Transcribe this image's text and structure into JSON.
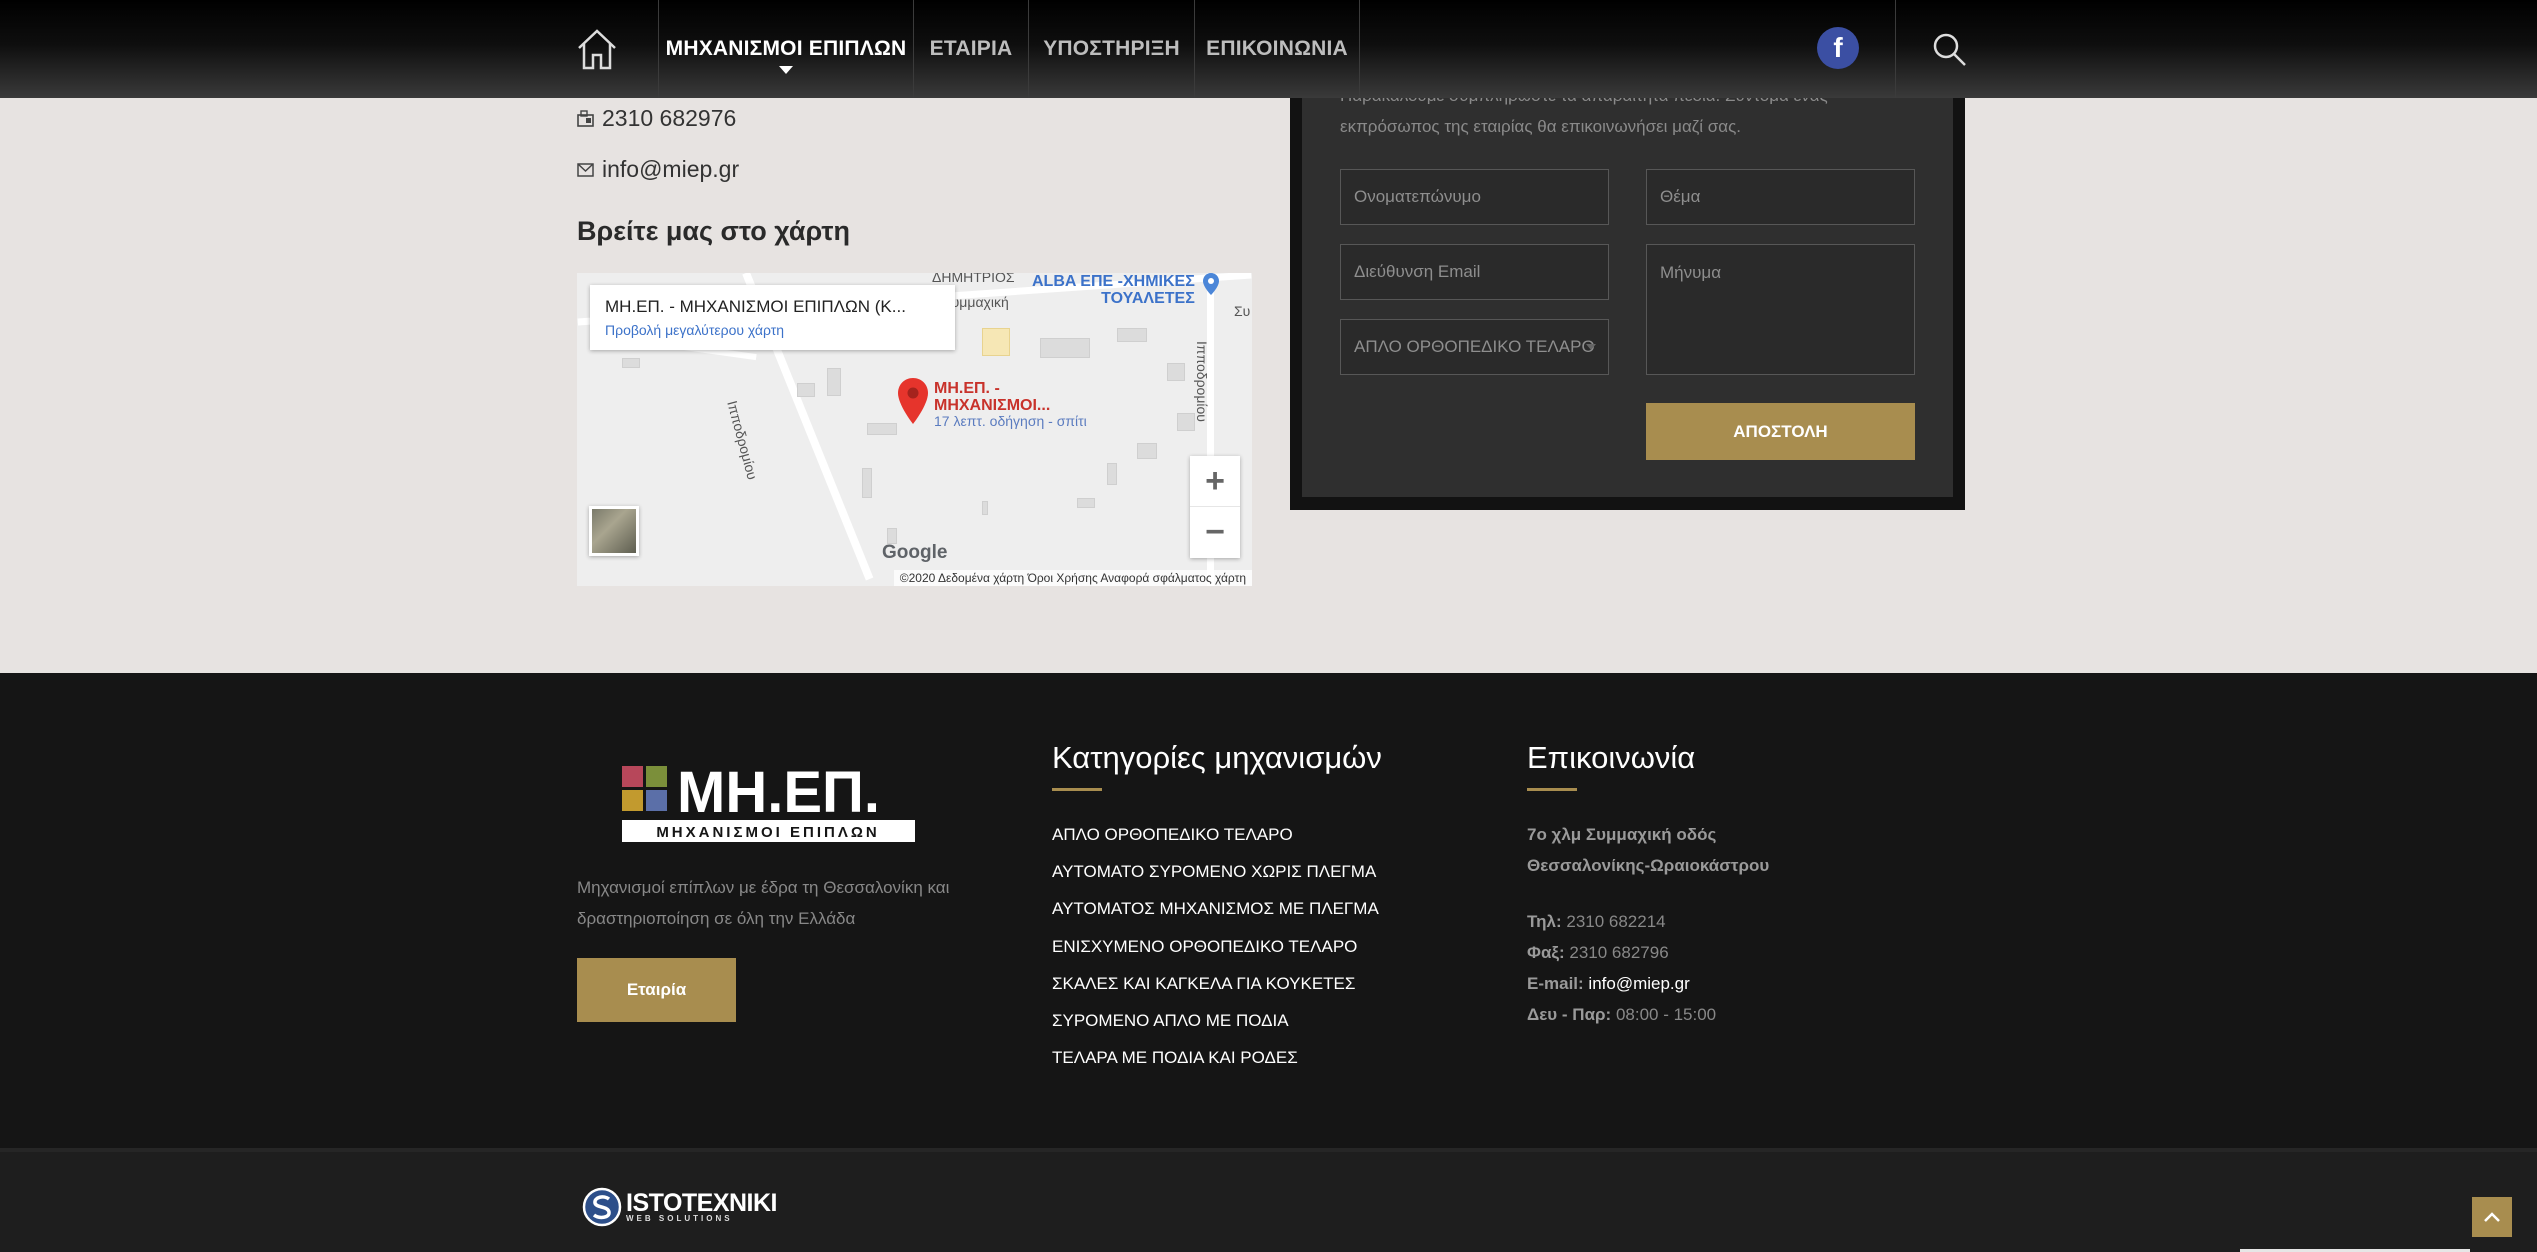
{
  "nav": {
    "items": [
      "ΜΗΧΑΝΙΣΜΟΙ ΕΠΙΠΛΩΝ",
      "ΕΤΑΙΡΙΑ",
      "ΥΠΟΣΤΗΡΙΞΗ",
      "ΕΠΙΚΟΙΝΩΝΙΑ"
    ],
    "active": "ΜΗΧΑΝΙΣΜΟΙ ΕΠΙΠΛΩΝ",
    "facebook_letter": "f"
  },
  "contact": {
    "phone": "2310 682976",
    "email": "info@miep.gr",
    "map_heading": "Βρείτε μας στο χάρτη"
  },
  "map": {
    "place_name": "ΜΗ.ΕΠ. - ΜΗΧΑΝΙΣΜΟΙ ΕΠΙΠΛΩΝ (Κ...",
    "larger_map": "Προβολή μεγαλύτερου χάρτη",
    "pin_label_1": "ΜΗ.ΕΠ. -",
    "pin_label_2": "ΜΗΧΑΝΙΣΜΟΙ...",
    "pin_sub": "17 λεπτ. οδήγηση - σπίτι",
    "poi_1": "ALBA ΕΠΕ -ΧΗΜΙΚΕΣ",
    "poi_2": "ΤΟΥΑΛΕΤΕΣ",
    "street_1": "ΔΗΜΗΤΡΙΟΣ",
    "street_2": "Συμμαχική",
    "street_3": "Ιπποδρομίου",
    "street_4": "Ιπποδρομίου",
    "street_5": "Συ",
    "zoom_in": "+",
    "zoom_out": "−",
    "google": "Google",
    "footer": "©2020 Δεδομένα χάρτη  Όροι Χρήσης  Αναφορά σφάλματος χάρτη"
  },
  "form": {
    "intro": "Παρακαλούμε συμπληρώστε τα απαραίτητα πεδία. Σύντομα ένας εκπρόσωπος της εταιρίας θα επικοινωνήσει μαζί σας.",
    "name_placeholder": "Ονοματεπώνυμο",
    "subject_placeholder": "Θέμα",
    "email_placeholder": "Διεύθυνση Email",
    "message_placeholder": "Μήνυμα",
    "product_selected": "ΑΠΛΟ ΟΡΘΟΠΕΔΙΚΟ ΤΕΛΑΡΟ",
    "submit": "ΑΠΟΣΤΟΛΗ"
  },
  "footer": {
    "logo_text": "ΜΗ.ΕΠ.",
    "logo_sub": "ΜΗΧΑΝΙΣΜΟΙ ΕΠΙΠΛΩΝ",
    "about": "Μηχανισμοί επίπλων με έδρα τη Θεσσαλονίκη και δραστηριοποίηση σε όλη την Ελλάδα",
    "about_button": "Εταιρία",
    "categories_heading": "Κατηγορίες μηχανισμών",
    "categories": [
      "ΑΠΛΟ ΟΡΘΟΠΕΔΙΚΟ ΤΕΛΑΡΟ",
      "ΑΥΤΟΜΑΤΟ ΣΥΡΟΜΕΝΟ ΧΩΡΙΣ ΠΛΕΓΜΑ",
      "ΑΥΤΟΜΑΤΟΣ ΜΗΧΑΝΙΣΜΟΣ ΜΕ ΠΛΕΓΜΑ",
      "ΕΝΙΣΧΥΜΕΝΟ ΟΡΘΟΠΕΔΙΚΟ ΤΕΛΑΡΟ",
      "ΣΚΑΛΕΣ ΚΑΙ ΚΑΓΚΕΛΑ ΓΙΑ ΚΟΥΚΕΤΕΣ",
      "ΣΥΡΟΜΕΝΟ ΑΠΛΟ ΜΕ ΠΟΔΙΑ",
      "ΤΕΛΑΡΑ ΜΕ ΠΟΔΙΑ ΚΑΙ ΡΟΔΕΣ"
    ],
    "contact_heading": "Επικοινωνία",
    "address_1": "7ο χλμ Συμμαχική οδός",
    "address_2": "Θεσσαλονίκης-Ωραιοκάστρου",
    "tel_label": "Τηλ:",
    "tel": "2310 682214",
    "fax_label": "Φαξ:",
    "fax": "2310 682796",
    "email_label": "E-mail:",
    "email": "info@miep.gr",
    "hours_label": "Δευ - Παρ:",
    "hours": "08:00 - 15:00",
    "credit_name": "ISTOTEXNIKI",
    "credit_sub": "WEB SOLUTIONS"
  },
  "colors": {
    "accent_gold": "#a88d4f",
    "footer_bg": "#151515",
    "page_bg": "#e7e3e1",
    "facebook": "#3b4fa3"
  }
}
